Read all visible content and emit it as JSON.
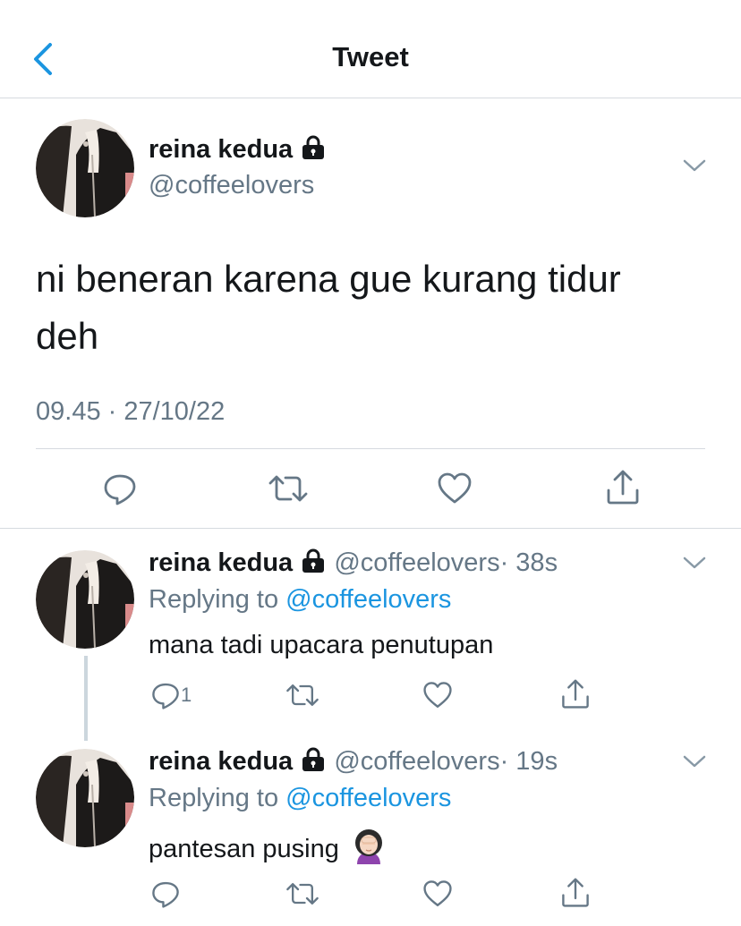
{
  "header": {
    "title": "Tweet"
  },
  "main_tweet": {
    "name": "reina kedua",
    "handle": "@coffeelovers",
    "text_line1": "ni beneran karena gue kurang tidur",
    "text_line2": "deh",
    "timestamp": "09.45 · 27/10/22"
  },
  "replies": [
    {
      "name": "reina kedua",
      "handle": "@coffeelovers",
      "time": "· 38s",
      "replying_prefix": "Replying to",
      "replying_handle": "@coffeelovers",
      "text": "mana tadi upacara penutupan",
      "reply_count": "1"
    },
    {
      "name": "reina kedua",
      "handle": "@coffeelovers",
      "time": "· 19s",
      "replying_prefix": "Replying to",
      "replying_handle": "@coffeelovers",
      "text": "pantesan pusing",
      "emoji": "woman-facepalming"
    }
  ],
  "colors": {
    "accent": "#1b95e0",
    "text": "#14171a",
    "muted": "#657786",
    "divider": "#d6dadf",
    "icon": "#657786"
  }
}
